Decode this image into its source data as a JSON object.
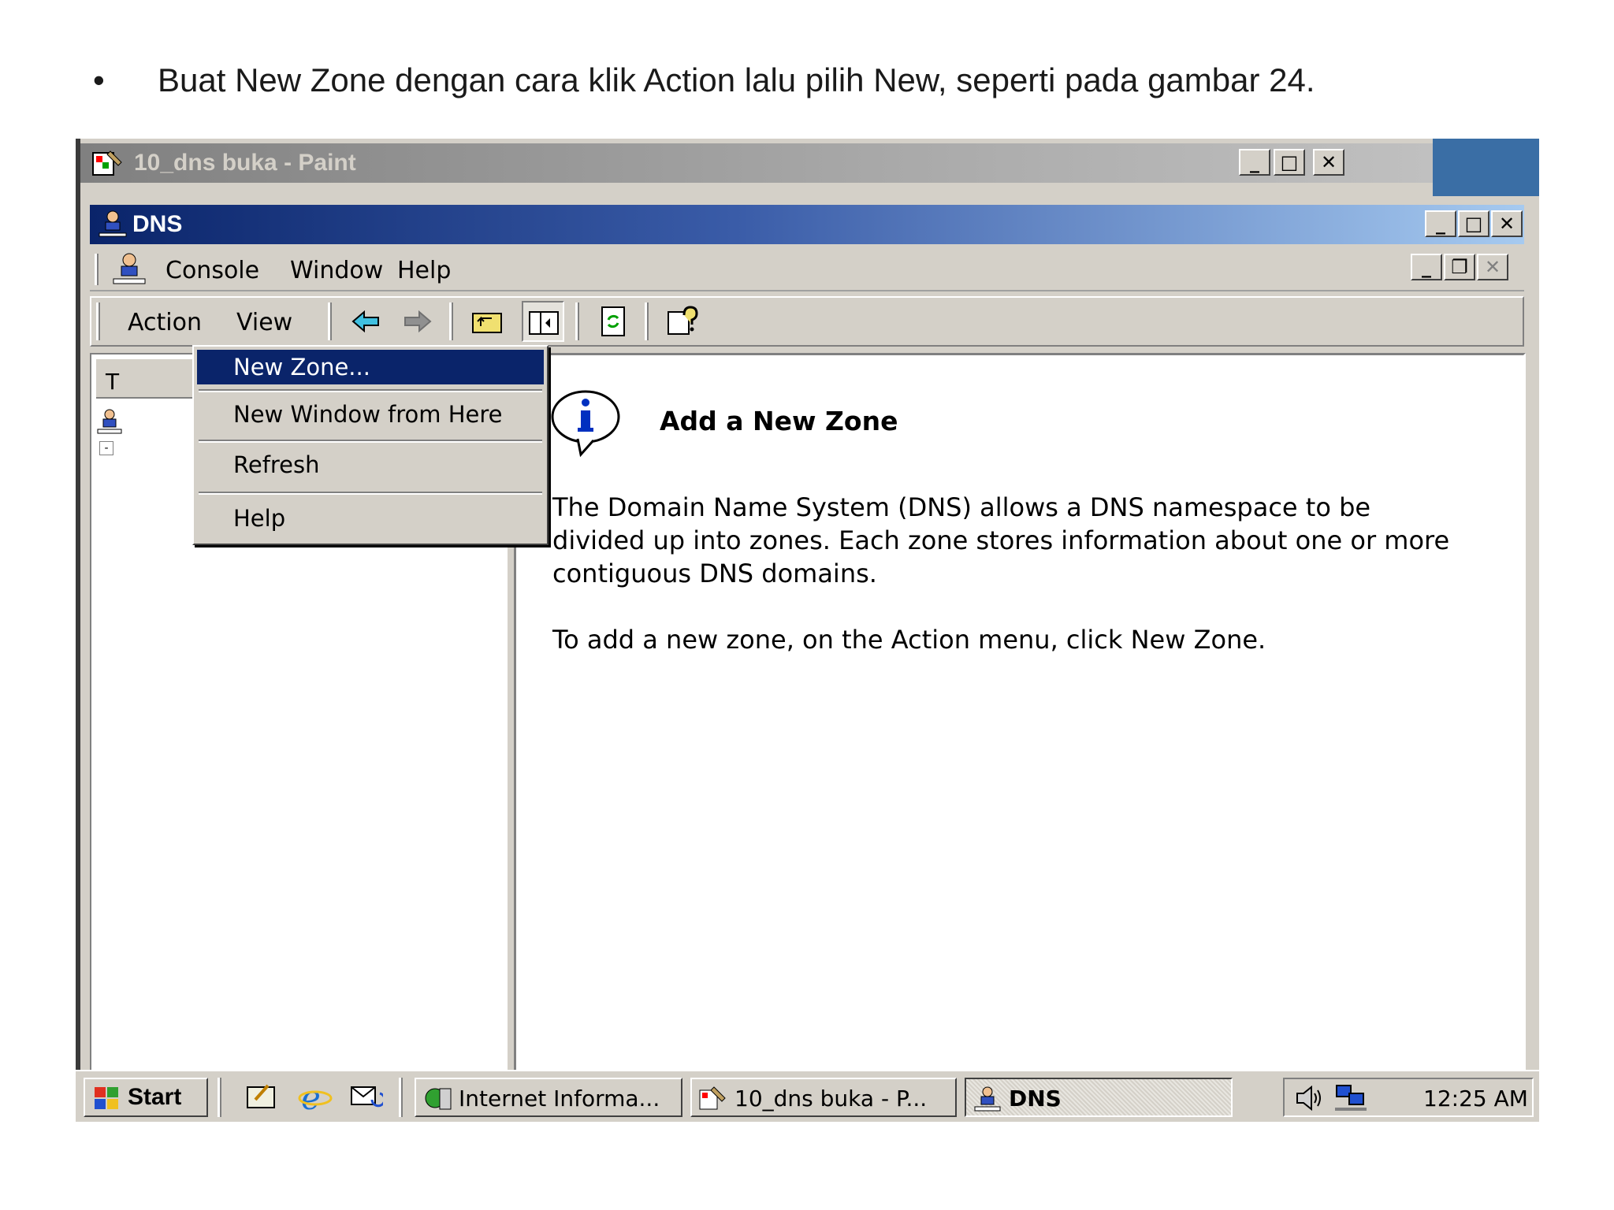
{
  "slide": {
    "bullet": "•",
    "caption": "Buat New Zone dengan cara klik Action lalu pilih New, seperti pada gambar 24."
  },
  "paint_window": {
    "title": "10_dns buka - Paint",
    "buttons": {
      "minimize": "_",
      "maximize": "□",
      "close": "✕"
    }
  },
  "dns_window": {
    "title": "DNS",
    "buttons": {
      "minimize": "_",
      "maximize": "□",
      "close": "✕"
    },
    "child_buttons": {
      "minimize": "_",
      "restore": "❐",
      "close": "✕"
    },
    "menubar": [
      "Console",
      "Window",
      "Help"
    ],
    "toolbar_menus": [
      "Action",
      "View"
    ],
    "tree_tab_stub": "T"
  },
  "action_menu": {
    "items": [
      "New Zone...",
      "New Window from Here",
      "Refresh",
      "Help"
    ],
    "selected": "New Zone..."
  },
  "right_pane": {
    "heading": "Add a New Zone",
    "paragraph1": "The Domain Name System (DNS) allows a DNS namespace to be divided up into zones. Each zone stores information about one or more contiguous DNS domains.",
    "paragraph2": "To add a new zone, on the Action menu, click New Zone."
  },
  "taskbar": {
    "start": "Start",
    "tasks": [
      "Internet Informa...",
      "10_dns buka - P...",
      "DNS"
    ],
    "active_task": "DNS",
    "clock": "12:25 AM"
  },
  "colors": {
    "title_active_start": "#0a246a",
    "title_active_end": "#a6caf0",
    "menu_highlight": "#0a246a",
    "face": "#d4d0c8",
    "desktop": "#3a6ea5"
  }
}
